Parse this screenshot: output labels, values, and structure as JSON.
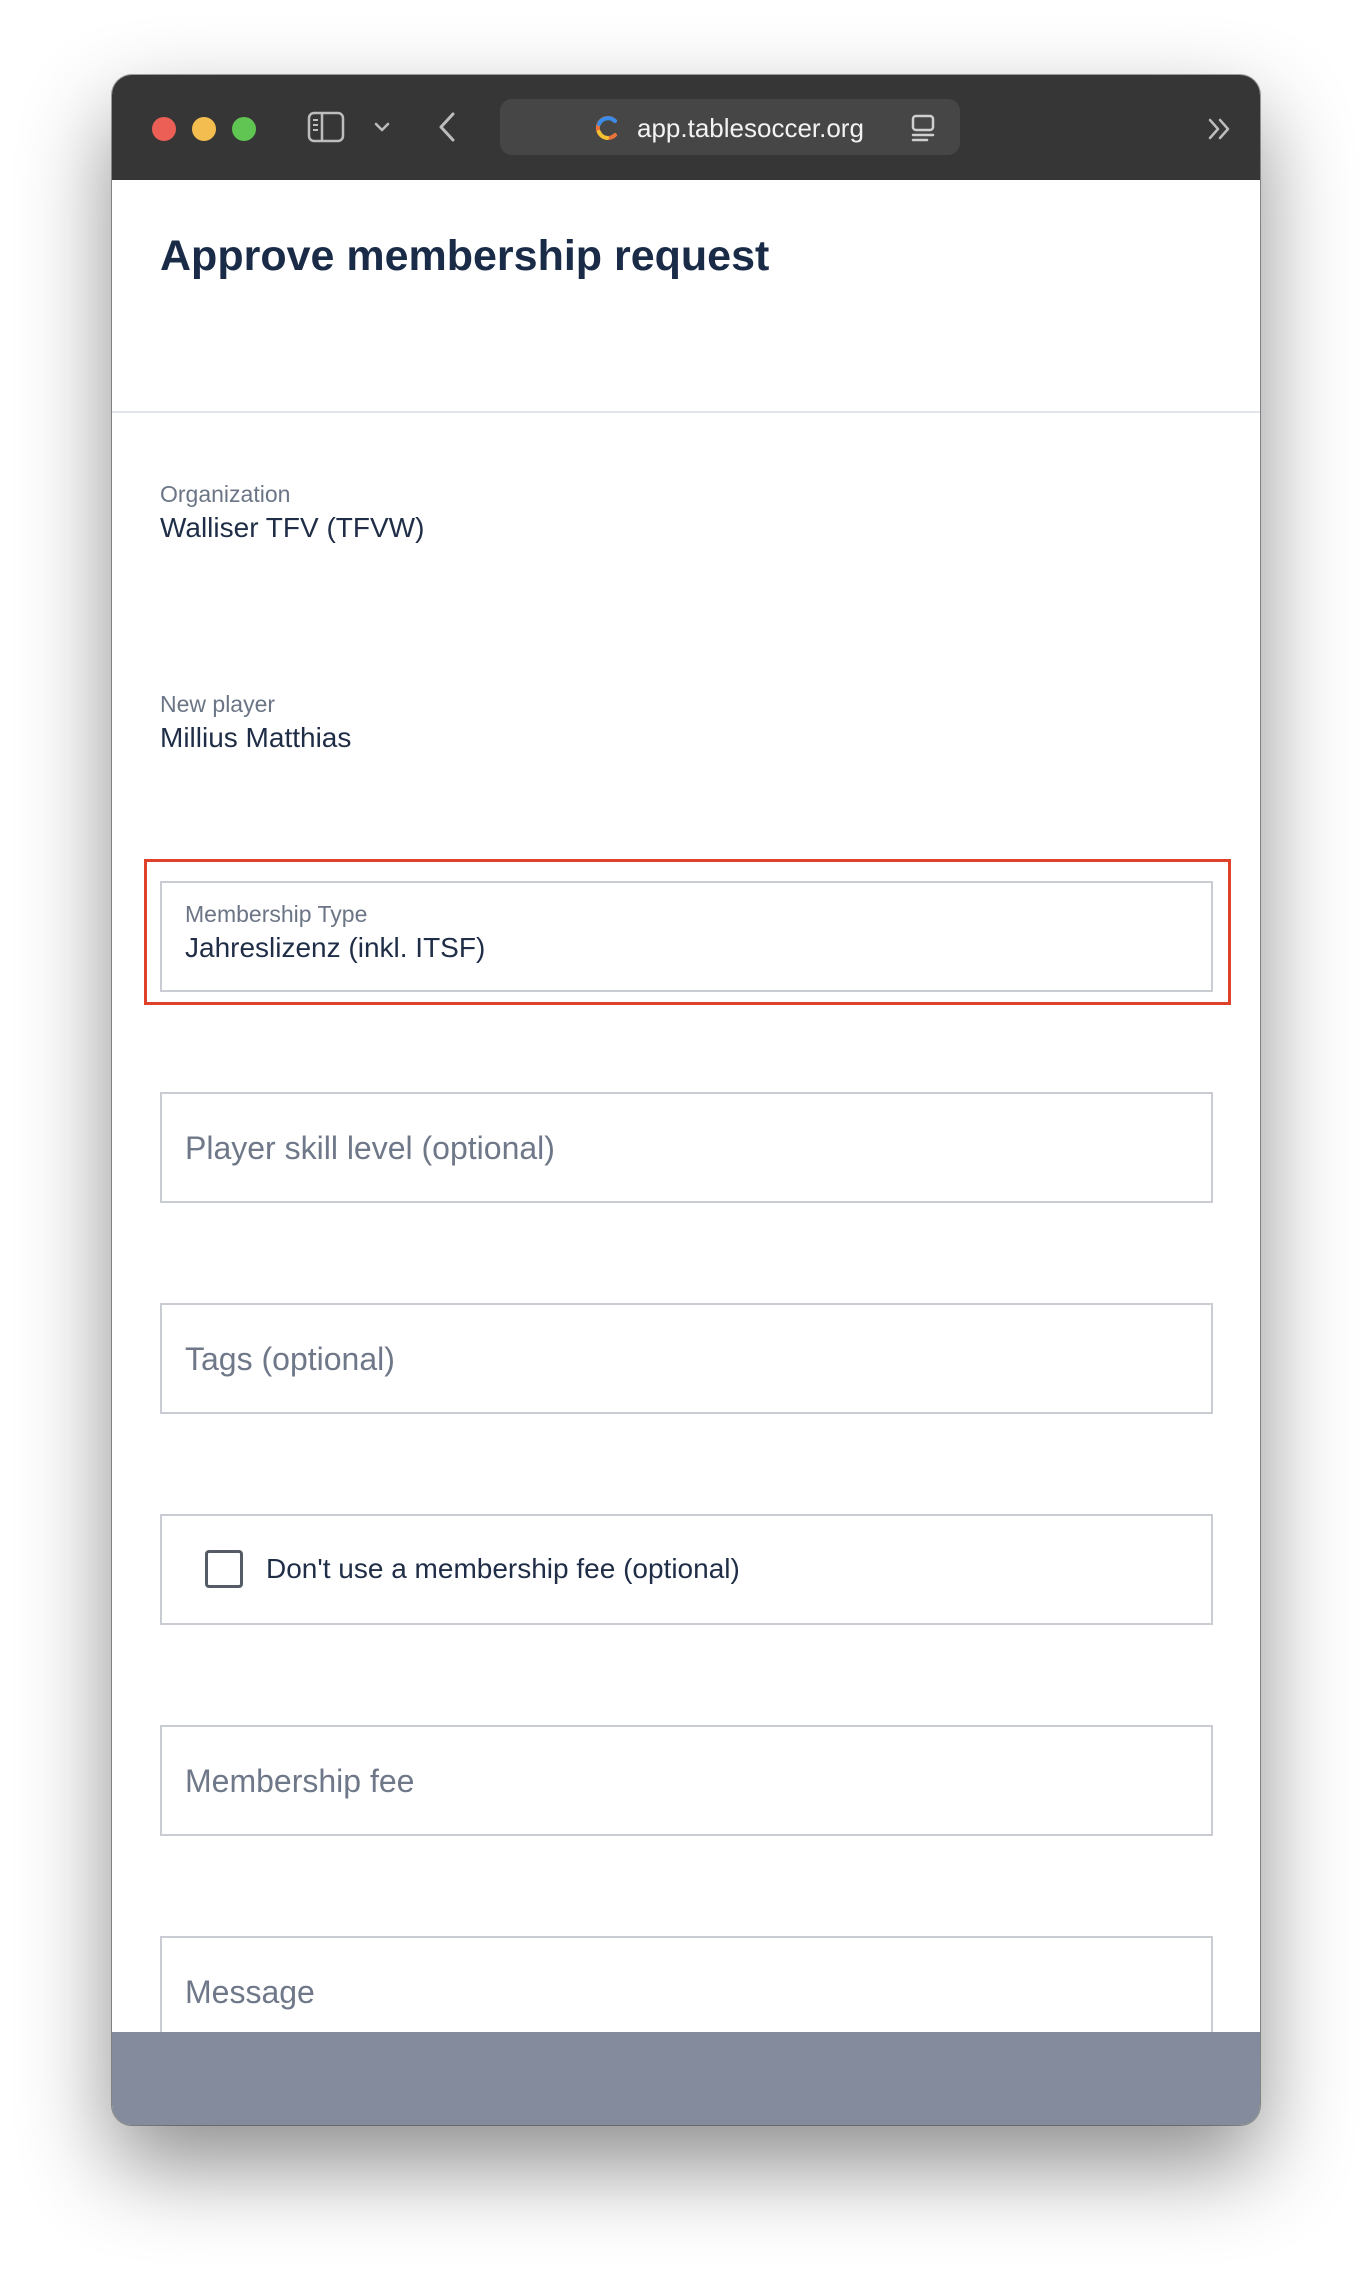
{
  "browser": {
    "url": "app.tablesoccer.org"
  },
  "page": {
    "title": "Approve membership request"
  },
  "organization": {
    "label": "Organization",
    "value": "Walliser TFV (TFVW)"
  },
  "new_player": {
    "label": "New player",
    "value": "Millius Matthias"
  },
  "membership_type": {
    "label": "Membership Type",
    "value": "Jahreslizenz (inkl. ITSF)"
  },
  "skill_level": {
    "placeholder": "Player skill level (optional)"
  },
  "tags": {
    "placeholder": "Tags (optional)"
  },
  "no_fee_checkbox": {
    "label": "Don't use a membership fee (optional)",
    "checked": false
  },
  "membership_fee": {
    "placeholder": "Membership fee"
  },
  "message": {
    "placeholder": "Message"
  },
  "colors": {
    "highlight": "#e0412b",
    "title_text": "#1a2b48",
    "titlebar": "#363636",
    "footer": "#848b9c"
  }
}
